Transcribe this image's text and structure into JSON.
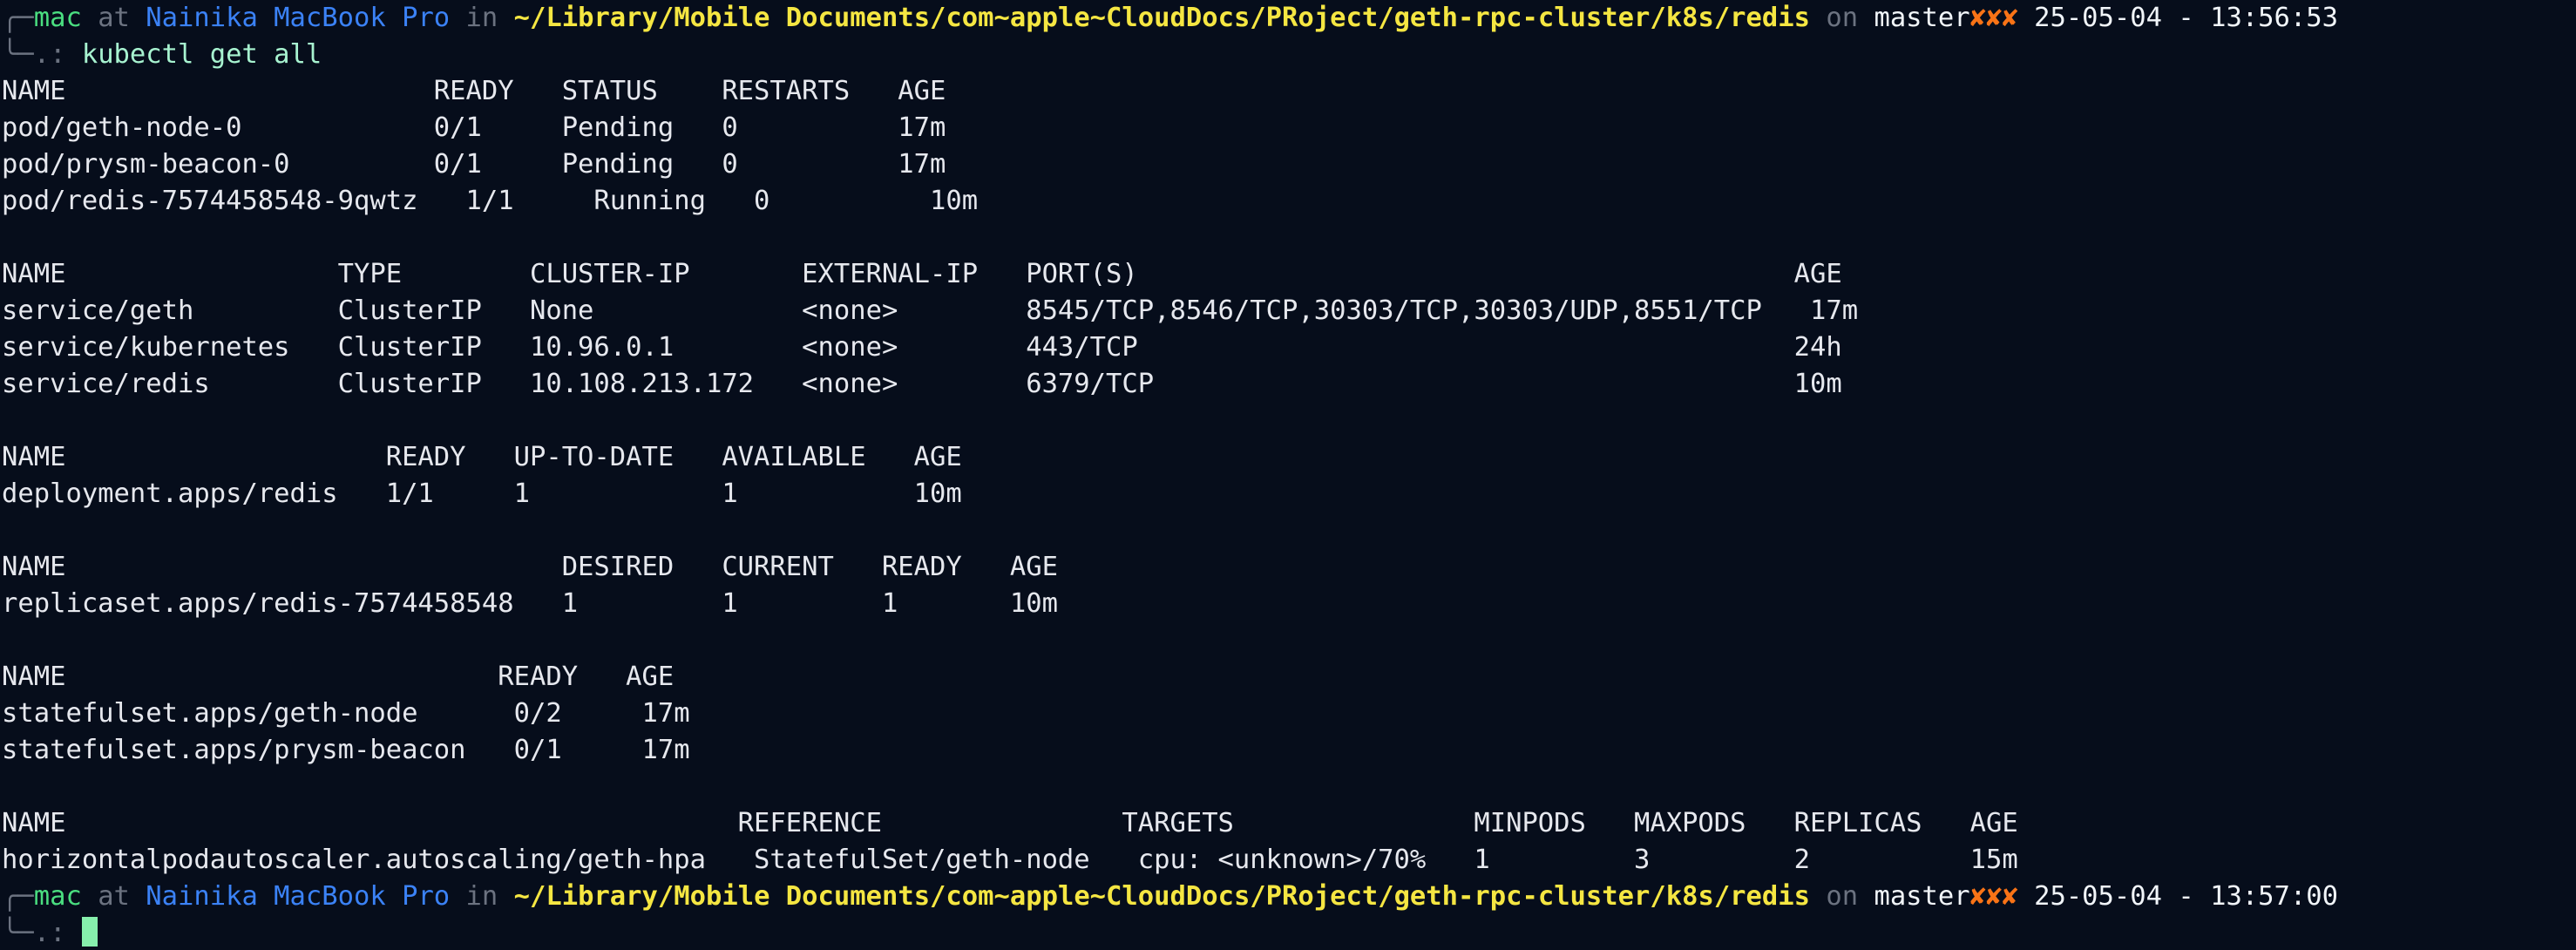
{
  "prompt1": {
    "corner": "╭─",
    "user": "mac",
    "at": " at ",
    "host": "Nainika MacBook Pro",
    "in": " in ",
    "path": "~/Library/Mobile Documents/com~apple~CloudDocs/PRoject/geth-rpc-cluster/k8s/redis",
    "on": " on ",
    "branch": "master",
    "dirty": "✘✘✘",
    "time": " 25-05-04 - 13:56:53",
    "tail": "╰─",
    "symbol": ".:",
    "command": " kubectl get all"
  },
  "output": [
    "NAME                       READY   STATUS    RESTARTS   AGE",
    "pod/geth-node-0            0/1     Pending   0          17m",
    "pod/prysm-beacon-0         0/1     Pending   0          17m",
    "pod/redis-7574458548-9qwtz   1/1     Running   0          10m",
    "",
    "NAME                 TYPE        CLUSTER-IP       EXTERNAL-IP   PORT(S)                                         AGE",
    "service/geth         ClusterIP   None             <none>        8545/TCP,8546/TCP,30303/TCP,30303/UDP,8551/TCP   17m",
    "service/kubernetes   ClusterIP   10.96.0.1        <none>        443/TCP                                         24h",
    "service/redis        ClusterIP   10.108.213.172   <none>        6379/TCP                                        10m",
    "",
    "NAME                    READY   UP-TO-DATE   AVAILABLE   AGE",
    "deployment.apps/redis   1/1     1            1           10m",
    "",
    "NAME                               DESIRED   CURRENT   READY   AGE",
    "replicaset.apps/redis-7574458548   1         1         1       10m",
    "",
    "NAME                           READY   AGE",
    "statefulset.apps/geth-node      0/2     17m",
    "statefulset.apps/prysm-beacon   0/1     17m",
    "",
    "NAME                                          REFERENCE               TARGETS               MINPODS   MAXPODS   REPLICAS   AGE",
    "horizontalpodautoscaler.autoscaling/geth-hpa   StatefulSet/geth-node   cpu: <unknown>/70%   1         3         2          15m"
  ],
  "prompt2": {
    "corner": "╭─",
    "user": "mac",
    "at": " at ",
    "host": "Nainika MacBook Pro",
    "in": " in ",
    "path": "~/Library/Mobile Documents/com~apple~CloudDocs/PRoject/geth-rpc-cluster/k8s/redis",
    "on": " on ",
    "branch": "master",
    "dirty": "✘✘✘",
    "time": " 25-05-04 - 13:57:00",
    "tail": "╰─",
    "symbol": ".:",
    "command": " "
  },
  "colors": {
    "background": "#060d1b",
    "user": "#4ade80",
    "host": "#3b82f6",
    "path": "#f5e642",
    "dirty": "#f97316",
    "cursor": "#86efac"
  }
}
